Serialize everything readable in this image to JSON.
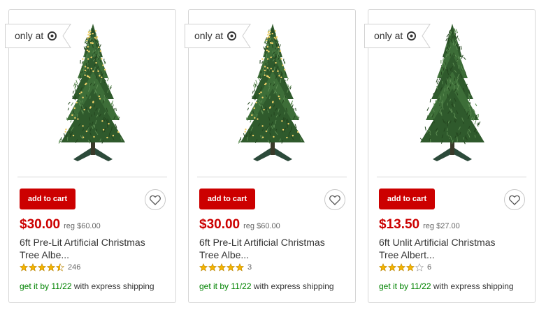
{
  "products": [
    {
      "badge": "only at",
      "add_to_cart": "add to cart",
      "price": "$30.00",
      "reg_price": "reg $60.00",
      "title_line1": "6ft Pre-Lit Artificial Christmas",
      "title_line2": "Tree Albe...",
      "rating": 4.5,
      "review_count": "246",
      "ship_prefix": "get it by",
      "ship_date": "11/22",
      "ship_suffix": "with express shipping",
      "lit": true
    },
    {
      "badge": "only at",
      "add_to_cart": "add to cart",
      "price": "$30.00",
      "reg_price": "reg $60.00",
      "title_line1": "6ft Pre-Lit Artificial Christmas",
      "title_line2": "Tree Albe...",
      "rating": 5,
      "review_count": "3",
      "ship_prefix": "get it by",
      "ship_date": "11/22",
      "ship_suffix": "with express shipping",
      "lit": true
    },
    {
      "badge": "only at",
      "add_to_cart": "add to cart",
      "price": "$13.50",
      "reg_price": "reg $27.00",
      "title_line1": "6ft Unlit Artificial Christmas",
      "title_line2": "Tree Albert...",
      "rating": 4,
      "review_count": "6",
      "ship_prefix": "get it by",
      "ship_date": "11/22",
      "ship_suffix": "with express shipping",
      "lit": false
    }
  ],
  "colors": {
    "brand_red": "#cc0000",
    "ship_green": "#008300",
    "star_gold": "#f5b400"
  },
  "icons": {
    "badge": "target-logo-icon",
    "wishlist": "heart-icon",
    "rating": "star-icon"
  }
}
